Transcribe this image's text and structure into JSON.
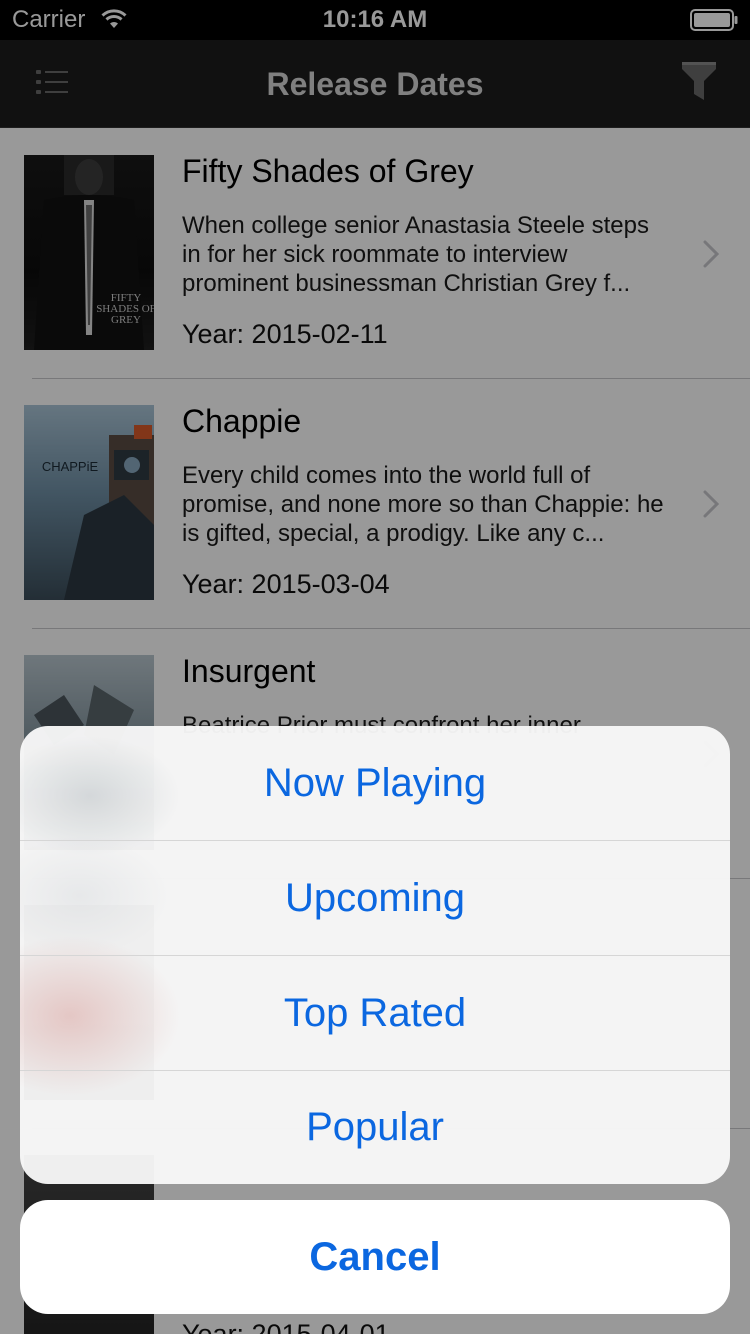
{
  "status_bar": {
    "carrier": "Carrier",
    "time": "10:16 AM"
  },
  "nav": {
    "title": "Release Dates",
    "left_icon": "list-menu-icon",
    "right_icon": "filter-icon"
  },
  "movies": [
    {
      "title": "Fifty Shades of Grey",
      "overview": "When college senior Anastasia Steele steps in for her sick roommate to interview prominent businessman Christian Grey f...",
      "year": "Year: 2015-02-11",
      "poster_text": "FIFTY SHADES OF GREY"
    },
    {
      "title": "Chappie",
      "overview": "Every child comes into the world full of promise, and none more so than Chappie: he is gifted, special, a prodigy. Like any c...",
      "year": "Year: 2015-03-04",
      "poster_text": "CHAPPiE"
    },
    {
      "title": "Insurgent",
      "overview": "Beatrice Prior must confront her inner",
      "year": "",
      "poster_text": ""
    },
    {
      "title": "",
      "overview": "",
      "year": "",
      "poster_text": ""
    },
    {
      "title": "",
      "overview": "",
      "year": "Year: 2015-04-01",
      "poster_text": ""
    }
  ],
  "action_sheet": {
    "options": [
      "Now Playing",
      "Upcoming",
      "Top Rated",
      "Popular"
    ],
    "cancel": "Cancel"
  },
  "colors": {
    "accent": "#0b67e0",
    "nav_background": "#1d1d1d",
    "nav_title": "#d6d6d6"
  }
}
